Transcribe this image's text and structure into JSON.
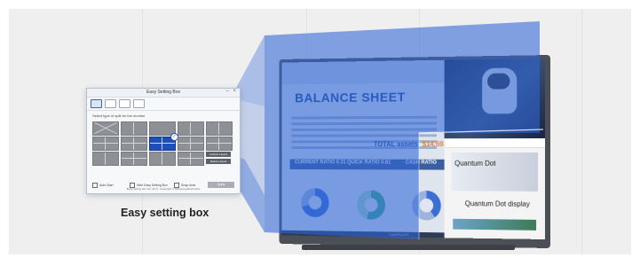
{
  "caption": "Easy setting box",
  "colors": {
    "overlay": "#2f66d8",
    "accent": "#1d4fb5",
    "selection": "#1d4fb5"
  },
  "dialog": {
    "title": "Easy Setting Box",
    "close_icon": "close-icon",
    "minimize_icon": "minimize-icon",
    "tabs": [
      {
        "icon": "monitor-layout-icon-1",
        "active": true
      },
      {
        "icon": "monitor-layout-icon-2",
        "active": false
      },
      {
        "icon": "monitor-layout-icon-3",
        "active": false
      },
      {
        "icon": "monitor-layout-icon-4",
        "active": false
      }
    ],
    "instruction": "Select type of split for the monitor",
    "side_buttons": [
      "Custom Layout",
      "Delete Layout"
    ],
    "options": [
      "Auto Start",
      "Hide Easy Setting Box",
      "Snap Area"
    ],
    "apply_label": "Apply",
    "footer": "Easy setting box Ver 3.0.0 · Copyright © Samsung Electronics",
    "selected_layout": "row 3, column 3"
  },
  "monitor": {
    "brand": "SAMSUNG",
    "spreadsheet": {
      "title": "BALANCE SHEET",
      "total_label": "TOTAL assets",
      "total_value": "$14,593.00",
      "bar_labels": [
        "CURRENT RATIO  0.31",
        "QUICK RATIO  0.81",
        "CASH RATIO"
      ]
    },
    "website": {
      "headline": "Quantum Dot",
      "subhead": "Quantum Dot display"
    }
  }
}
